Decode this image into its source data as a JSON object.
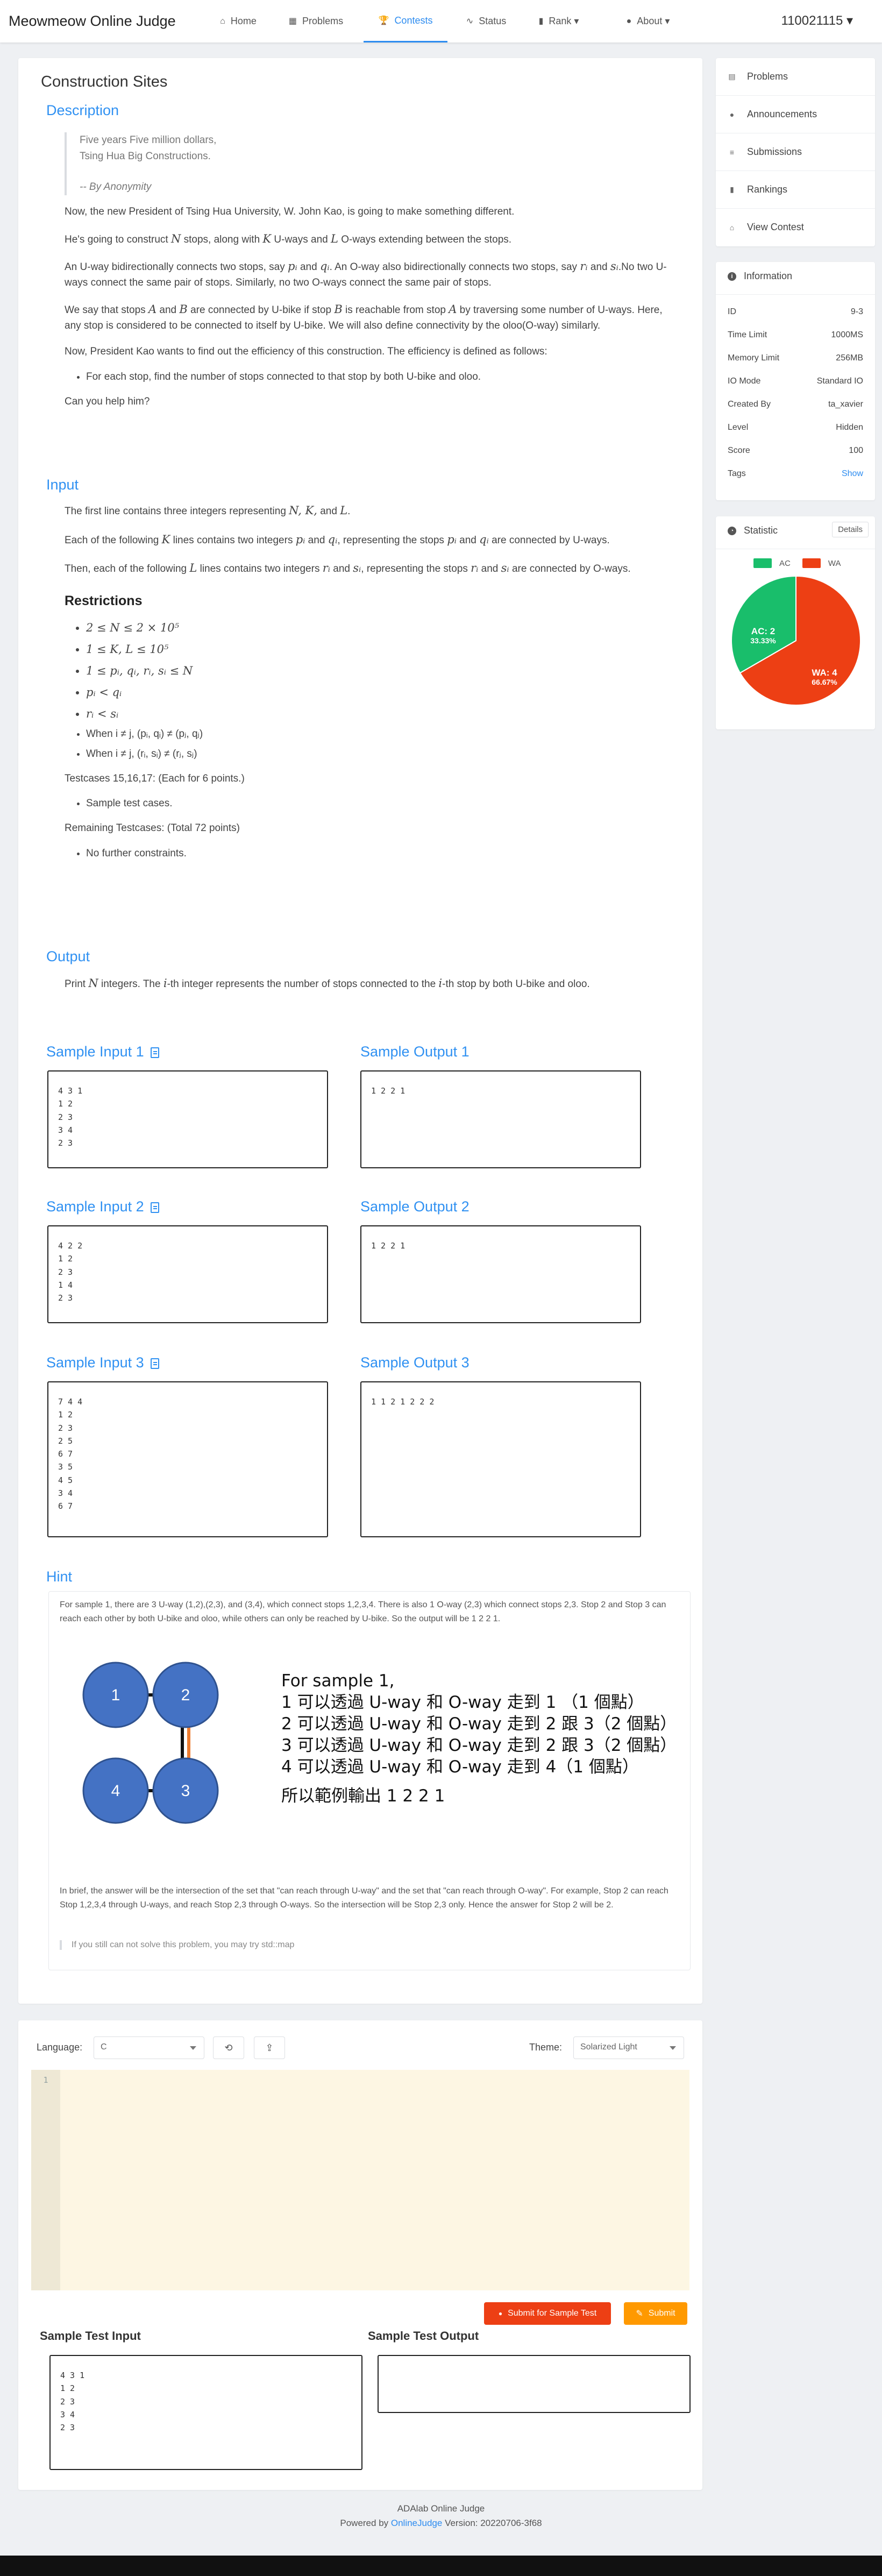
{
  "nav": {
    "brand": "Meowmeow Online Judge",
    "items": [
      {
        "label": "Home",
        "icon": "home-icon",
        "glyph": "⌂"
      },
      {
        "label": "Problems",
        "icon": "grid-icon",
        "glyph": "▦"
      },
      {
        "label": "Contests",
        "icon": "trophy-icon",
        "glyph": "🏆"
      },
      {
        "label": "Status",
        "icon": "pulse-icon",
        "glyph": "∿"
      },
      {
        "label": "Rank ▾",
        "icon": "chart-icon",
        "glyph": "▮"
      },
      {
        "label": "About ▾",
        "icon": "info-icon",
        "glyph": "●"
      }
    ],
    "user": "110021115 ▾",
    "accent": "#2d8cf0"
  },
  "problem": {
    "title": "Construction Sites",
    "description": {
      "heading": "Description",
      "quote_line1": "Five years Five million dollars,",
      "quote_line2": "Tsing Hua Big Constructions.",
      "quote_by": "-- By Anonymity",
      "p1": "Now, the new President of Tsing Hua University, W. John Kao, is going to make something different.",
      "p2a": "He's going to construct ",
      "p2N": "N",
      "p2b": " stops, along with ",
      "p2K": "K",
      "p2c": " U-ways and ",
      "p2L": "L",
      "p2d": " O-ways extending between the stops.",
      "p3a": "An U-way bidirectionally connects two stops, say ",
      "p3p": "pᵢ",
      "p3b": " and ",
      "p3q": "qᵢ",
      "p3c": ". An O-way also bidirectionally connects two stops, say ",
      "p3r": "rᵢ",
      "p3d": " and ",
      "p3s": "sᵢ",
      "p3e": ".No two U-ways connect the same pair of stops. Similarly, no two O-ways connect the same pair of stops.",
      "p4a": "We say that stops ",
      "p4A": "A",
      "p4b": " and ",
      "p4B": "B",
      "p4c": " are connected by U-bike if stop ",
      "p4B2": "B",
      "p4d": " is reachable from stop ",
      "p4A2": "A",
      "p4e": " by traversing some number of U-ways. Here, any stop is considered to be connected to itself by U-bike. We will also define connectivity by the oloo(O-way) similarly.",
      "p5": "Now, President Kao wants to find out the efficiency of this construction. The efficiency is defined as follows:",
      "bullet": "For each stop, find the number of stops connected to that stop by both U-bike and oloo.",
      "p6": "Can you help him?"
    },
    "input": {
      "heading": "Input",
      "p1a": "The first line contains three integers representing ",
      "p1m": "N, K,",
      "p1b": " and ",
      "p1m2": "L",
      "p1c": ".",
      "p2a": "Each of the following ",
      "p2K": "K",
      "p2b": " lines contains two integers ",
      "p2p": "pᵢ",
      "p2c": " and ",
      "p2q": "qᵢ",
      "p2d": ", representing the stops ",
      "p2p2": "pᵢ",
      "p2e": " and ",
      "p2q2": "qᵢ",
      "p2f": " are connected by U-ways.",
      "p3a": "Then, each of the following ",
      "p3L": "L",
      "p3b": " lines contains two integers ",
      "p3r": "rᵢ",
      "p3c": " and ",
      "p3s": "sᵢ",
      "p3d": ", representing the stops ",
      "p3r2": "rᵢ",
      "p3e": " and ",
      "p3s2": "sᵢ",
      "p3f": " are connected by O-ways.",
      "restrictions_heading": "Restrictions",
      "restrictions": [
        "2 ≤ N ≤ 2 × 10⁵",
        "1 ≤ K, L ≤ 10⁵",
        "1 ≤ pᵢ, qᵢ, rᵢ, sᵢ ≤ N",
        "pᵢ < qᵢ",
        "rᵢ < sᵢ",
        "When i ≠ j, (pᵢ, qᵢ) ≠ (pⱼ, qⱼ)",
        "When i ≠ j, (rᵢ, sᵢ) ≠ (rⱼ, sⱼ)"
      ],
      "tc1": "Testcases 15,16,17: (Each for 6 points.)",
      "tc1_bullet": "Sample test cases.",
      "tc2": "Remaining Testcases: (Total 72 points)",
      "tc2_bullet": "No further constraints."
    },
    "output": {
      "heading": "Output",
      "a": "Print ",
      "N": "N",
      "b": " integers. The ",
      "i": "i",
      "c": "-th integer represents the number of stops connected to the ",
      "i2": "i",
      "d": "-th stop by both U-bike and oloo."
    },
    "samples": [
      {
        "in_title": "Sample Input 1",
        "out_title": "Sample Output 1",
        "input": "4 3 1\n1 2\n2 3\n3 4\n2 3",
        "output": "1 2 2 1"
      },
      {
        "in_title": "Sample Input 2",
        "out_title": "Sample Output 2",
        "input": "4 2 2\n1 2\n2 3\n1 4\n2 3",
        "output": "1 2 2 1"
      },
      {
        "in_title": "Sample Input 3",
        "out_title": "Sample Output 3",
        "input": "7 4 4\n1 2\n2 3\n2 5\n6 7\n3 5\n4 5\n3 4\n6 7",
        "output": "1 1 2 1 2 2 2"
      }
    ],
    "hint": {
      "heading": "Hint",
      "p1": "For sample 1, there are 3 U-way (1,2),(2,3), and (3,4), which connect stops 1,2,3,4. There is also 1 O-way (2,3) which connect stops 2,3. Stop 2 and Stop 3 can reach each other by both U-bike and oloo, while others can only be reached by U-bike. So the output will be 1 2 2 1.",
      "nodes": [
        "1",
        "2",
        "4",
        "3"
      ],
      "fig_lines": [
        "For sample 1,",
        "1 可以透過 U-way 和 O-way 走到 1 （1 個點）",
        "2 可以透過 U-way 和 O-way 走到 2 跟 3（2 個點）",
        "3 可以透過 U-way 和 O-way 走到 2 跟 3（2 個點）",
        "4 可以透過 U-way 和 O-way 走到 4（1 個點）"
      ],
      "fig_result": "所以範例輸出 1 2 2 1",
      "p2": "In brief, the answer will be the intersection of the set that \"can reach through U-way\" and the set that \"can reach through O-way\". For example, Stop 2 can reach Stop 1,2,3,4 through U-ways, and reach Stop 2,3 through O-ways. So the intersection will be Stop 2,3 only. Hence the answer for Stop 2 will be 2.",
      "quote": "If you still can not solve this problem, you may try std::map"
    }
  },
  "sidebar": {
    "menu": [
      {
        "label": "Problems",
        "icon": "list-icon",
        "glyph": "▤"
      },
      {
        "label": "Announcements",
        "icon": "chat-icon",
        "glyph": "●"
      },
      {
        "label": "Submissions",
        "icon": "bars-icon",
        "glyph": "≡"
      },
      {
        "label": "Rankings",
        "icon": "ranking-icon",
        "glyph": "▮"
      },
      {
        "label": "View Contest",
        "icon": "home-icon",
        "glyph": "⌂"
      }
    ],
    "info_title": "Information",
    "info": [
      {
        "k": "ID",
        "v": "9-3"
      },
      {
        "k": "Time Limit",
        "v": "1000MS"
      },
      {
        "k": "Memory Limit",
        "v": "256MB"
      },
      {
        "k": "IO Mode",
        "v": "Standard IO"
      },
      {
        "k": "Created By",
        "v": "ta_xavier"
      },
      {
        "k": "Level",
        "v": "Hidden"
      },
      {
        "k": "Score",
        "v": "100"
      },
      {
        "k": "Tags",
        "v": "Show"
      }
    ],
    "statistic_title": "Statistic",
    "details_label": "Details",
    "legend": [
      {
        "label": "AC",
        "color": "#19be6b"
      },
      {
        "label": "WA",
        "color": "#ed3f14"
      }
    ],
    "pie": {
      "ac_label": "AC: 2",
      "ac_pct": "33.33%",
      "wa_label": "WA: 4",
      "wa_pct": "66.67%",
      "ac": 2,
      "wa": 4
    }
  },
  "editor": {
    "language_label": "Language:",
    "language_value": "C",
    "theme_label": "Theme:",
    "theme_value": "Solarized Light",
    "line_number": "1",
    "submit_sample_label": "Submit for Sample Test",
    "submit_label": "Submit",
    "sample_input_title": "Sample Test Input",
    "sample_output_title": "Sample Test Output",
    "sample_input": "4 3 1\n1 2\n2 3\n3 4\n2 3",
    "sample_output": ""
  },
  "footer": {
    "line1": "ADAlab Online Judge",
    "powered": "Powered by ",
    "link": "OnlineJudge",
    "version": "  Version: 20220706-3f68"
  }
}
